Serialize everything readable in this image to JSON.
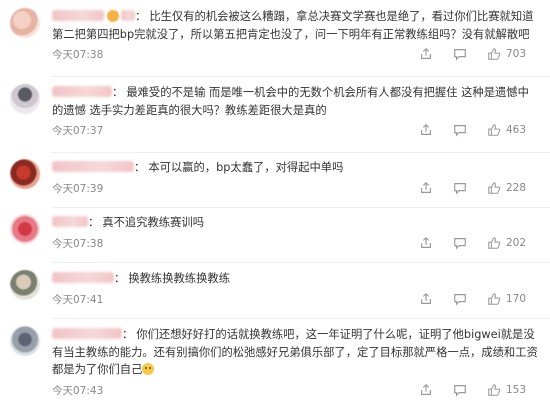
{
  "comments": [
    {
      "text": "比生仅有的机会被这么糟蹋，拿总决赛文学赛也是绝了，看过你们比赛就知道第二把第四把bp完就没了，所以第五把肯定也没了，问一下明年有正常教练组吗？没有就解散吧",
      "time": "今天07:38",
      "likes": "703"
    },
    {
      "text": "最难受的不是输 而是唯一机会中的无数个机会所有人都没有把握住 这种是遗憾中的遗憾 选手实力差距真的很大吗？教练差距很大是真的",
      "time": "今天07:37",
      "likes": "463"
    },
    {
      "text": "本可以赢的，bp太蠢了，对得起中单吗",
      "time": "今天07:39",
      "likes": "228"
    },
    {
      "text": "真不追究教练赛训吗",
      "time": "今天07:38",
      "likes": "202"
    },
    {
      "text": "换教练换教练换教练",
      "time": "今天07:41",
      "likes": "170"
    },
    {
      "text": "你们还想好好打的话就换教练吧，这一年证明了什么呢，证明了他bigwei就是没有当主教练的能力。还有别搞你们的松弛感好兄弟俱乐部了，定了目标那就严格一点，成绩和工资都是为了你们自己",
      "time": "今天07:43",
      "likes": "153"
    }
  ],
  "icons": {
    "share": "share-icon",
    "reply": "comment-icon",
    "like": "thumb-up-icon"
  },
  "colors": {
    "text": "#333333",
    "meta": "#888888",
    "divider": "#eeeeee"
  }
}
